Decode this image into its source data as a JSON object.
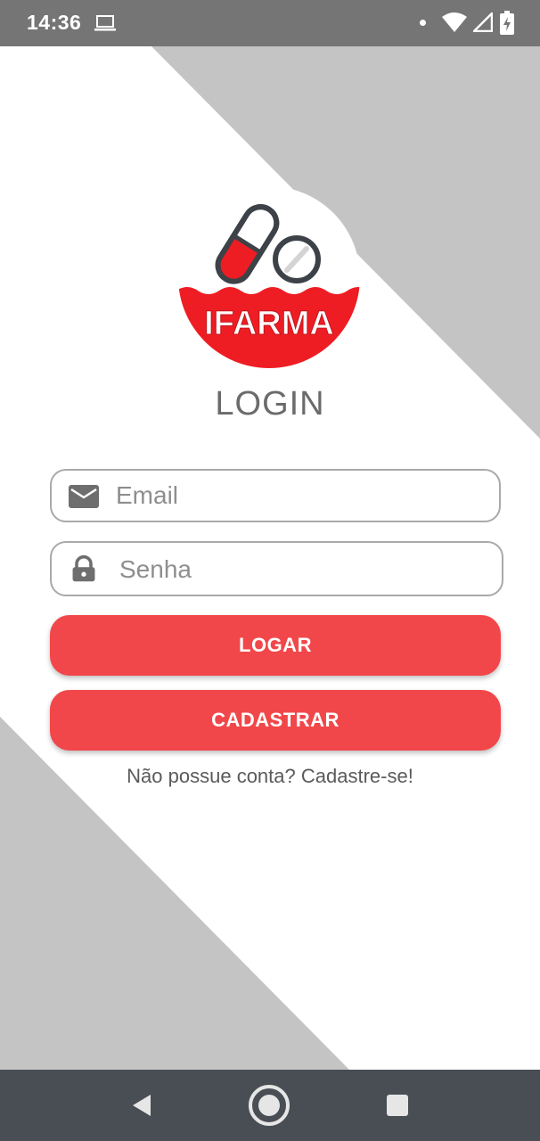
{
  "status_bar": {
    "time": "14:36",
    "icons": [
      "laptop-icon",
      "notification-dot-icon",
      "wifi-icon",
      "signal-icon",
      "battery-charging-icon"
    ]
  },
  "logo": {
    "text": "IFARMA",
    "colors": {
      "primary": "#ee1d24",
      "outline": "#3d4248"
    }
  },
  "login": {
    "title": "LOGIN",
    "email": {
      "placeholder": "Email",
      "value": "",
      "icon": "mail-icon"
    },
    "password": {
      "placeholder": "Senha",
      "value": "",
      "icon": "lock-icon"
    },
    "login_button": "LOGAR",
    "register_button": "CADASTRAR",
    "signup_prompt": "Não possue conta? Cadastre-se!"
  },
  "nav_bar": {
    "icons": [
      "back-icon",
      "home-icon",
      "recents-icon"
    ]
  },
  "colors": {
    "accent": "#f2474a",
    "background_shape": "#c4c4c4",
    "status_bar": "#757575",
    "nav_bar": "#494e55"
  }
}
